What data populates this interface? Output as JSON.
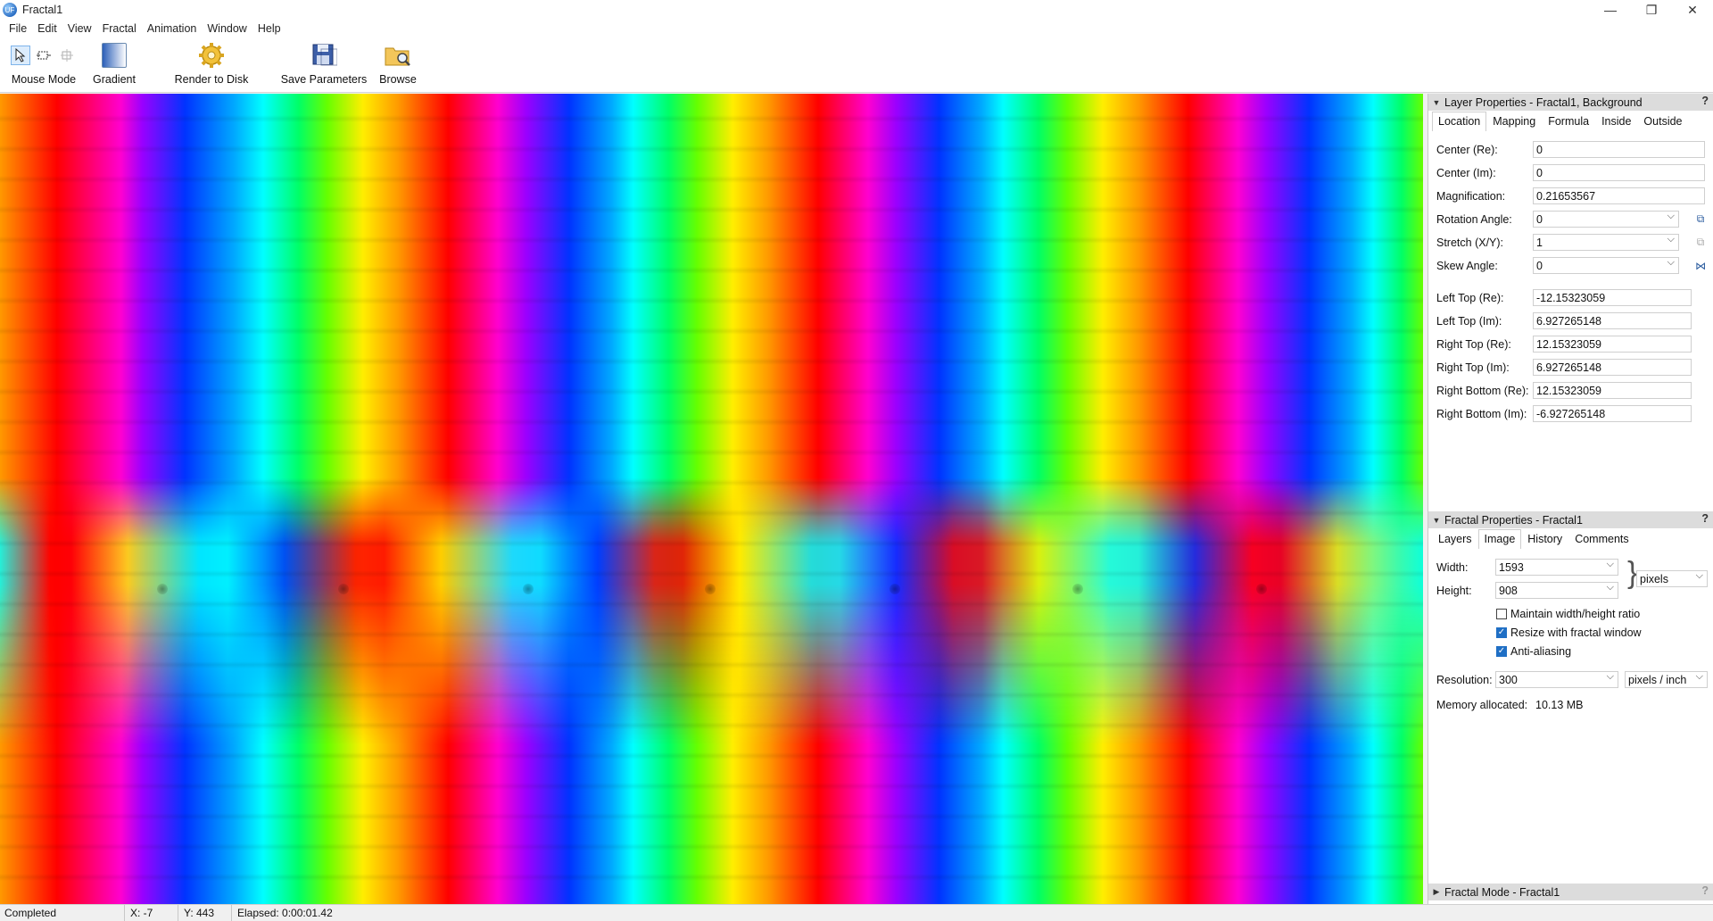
{
  "window": {
    "title": "Fractal1",
    "minimize": "—",
    "restore": "❐",
    "close": "✕"
  },
  "menu": [
    "File",
    "Edit",
    "View",
    "Fractal",
    "Animation",
    "Window",
    "Help"
  ],
  "toolbar": {
    "mouse_mode": "Mouse Mode",
    "gradient": "Gradient",
    "render_to_disk": "Render to Disk",
    "save_parameters": "Save Parameters",
    "browse": "Browse"
  },
  "layer_properties": {
    "header": "Layer Properties - Fractal1, Background",
    "help": "?",
    "tabs": [
      "Location",
      "Mapping",
      "Formula",
      "Inside",
      "Outside"
    ],
    "active_tab": "Location",
    "fields": [
      {
        "label": "Center (Re):",
        "value": "0"
      },
      {
        "label": "Center (Im):",
        "value": "0"
      },
      {
        "label": "Magnification:",
        "value": "0.21653567"
      },
      {
        "label": "Rotation Angle:",
        "value": "0"
      },
      {
        "label": "Stretch (X/Y):",
        "value": "1"
      },
      {
        "label": "Skew Angle:",
        "value": "0"
      }
    ],
    "corners": [
      {
        "label": "Left Top (Re):",
        "value": "-12.15323059"
      },
      {
        "label": "Left Top (Im):",
        "value": "6.927265148"
      },
      {
        "label": "Right Top (Re):",
        "value": "12.15323059"
      },
      {
        "label": "Right Top (Im):",
        "value": "6.927265148"
      },
      {
        "label": "Right Bottom (Re):",
        "value": "12.15323059"
      },
      {
        "label": "Right Bottom (Im):",
        "value": "-6.927265148"
      }
    ]
  },
  "fractal_properties": {
    "header": "Fractal Properties - Fractal1",
    "help": "?",
    "tabs": [
      "Layers",
      "Image",
      "History",
      "Comments"
    ],
    "active_tab": "Image",
    "width_label": "Width:",
    "width_value": "1593",
    "height_label": "Height:",
    "height_value": "908",
    "size_unit": "pixels",
    "maintain_ratio": {
      "label": "Maintain width/height ratio",
      "checked": false
    },
    "resize_with_window": {
      "label": "Resize with fractal window",
      "checked": true
    },
    "anti_aliasing": {
      "label": "Anti-aliasing",
      "checked": true
    },
    "resolution_label": "Resolution:",
    "resolution_value": "300",
    "resolution_unit": "pixels / inch",
    "memory_label": "Memory allocated:",
    "memory_value": "10.13 MB"
  },
  "fractal_mode": {
    "header": "Fractal Mode - Fractal1",
    "help": "?"
  },
  "status": {
    "state": "Completed",
    "x": "X: -7",
    "y": "Y: 443",
    "elapsed": "Elapsed: 0:00:01.42"
  },
  "colors": {
    "accent": "#1f6fc5",
    "panel_header": "#dcdcdc"
  }
}
